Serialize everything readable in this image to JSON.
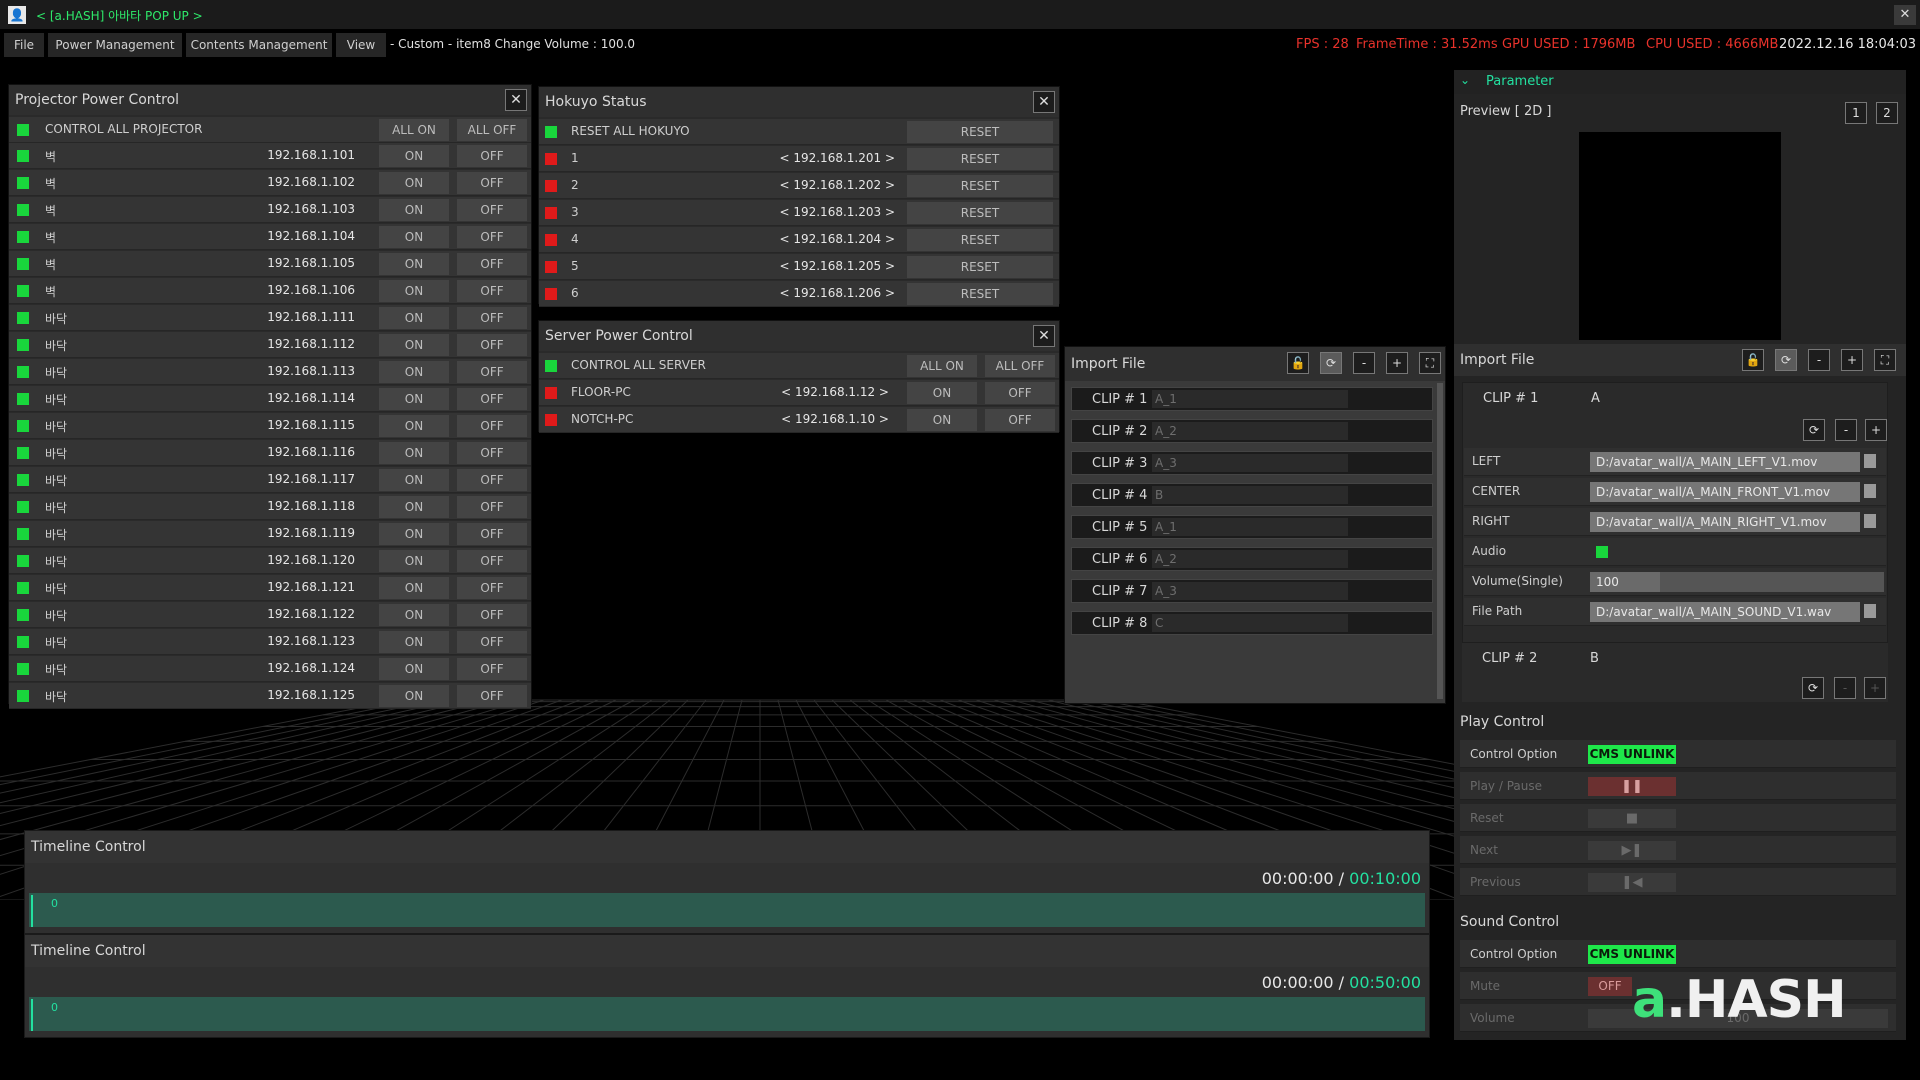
{
  "window": {
    "title": "< [a.HASH] 아바타 POP UP >",
    "close": "✕",
    "app_icon": "person-icon"
  },
  "menu": {
    "items": [
      "File",
      "Power Management",
      "Contents Management",
      "View"
    ],
    "status": "- Custom - item8 Change Volume : 100.0"
  },
  "perf": {
    "fps": "FPS : 28",
    "frametime": "FrameTime : 31.52ms",
    "gpu": "GPU USED : 1796MB",
    "cpu": "CPU USED : 4666MB",
    "clock": "2022.12.16 18:04:03"
  },
  "projector": {
    "title": "Projector Power Control",
    "all_label": "CONTROL ALL PROJECTOR",
    "all_on": "ALL ON",
    "all_off": "ALL OFF",
    "on": "ON",
    "off": "OFF",
    "rows": [
      {
        "name": "벽",
        "ip": "192.168.1.101"
      },
      {
        "name": "벽",
        "ip": "192.168.1.102"
      },
      {
        "name": "벽",
        "ip": "192.168.1.103"
      },
      {
        "name": "벽",
        "ip": "192.168.1.104"
      },
      {
        "name": "벽",
        "ip": "192.168.1.105"
      },
      {
        "name": "벽",
        "ip": "192.168.1.106"
      },
      {
        "name": "바닥",
        "ip": "192.168.1.111"
      },
      {
        "name": "바닥",
        "ip": "192.168.1.112"
      },
      {
        "name": "바닥",
        "ip": "192.168.1.113"
      },
      {
        "name": "바닥",
        "ip": "192.168.1.114"
      },
      {
        "name": "바닥",
        "ip": "192.168.1.115"
      },
      {
        "name": "바닥",
        "ip": "192.168.1.116"
      },
      {
        "name": "바닥",
        "ip": "192.168.1.117"
      },
      {
        "name": "바닥",
        "ip": "192.168.1.118"
      },
      {
        "name": "바닥",
        "ip": "192.168.1.119"
      },
      {
        "name": "바닥",
        "ip": "192.168.1.120"
      },
      {
        "name": "바닥",
        "ip": "192.168.1.121"
      },
      {
        "name": "바닥",
        "ip": "192.168.1.122"
      },
      {
        "name": "바닥",
        "ip": "192.168.1.123"
      },
      {
        "name": "바닥",
        "ip": "192.168.1.124"
      },
      {
        "name": "바닥",
        "ip": "192.168.1.125"
      }
    ]
  },
  "hokuyo": {
    "title": "Hokuyo Status",
    "all_label": "RESET ALL HOKUYO",
    "reset": "RESET",
    "rows": [
      {
        "name": "1",
        "ip": "< 192.168.1.201 >"
      },
      {
        "name": "2",
        "ip": "< 192.168.1.202 >"
      },
      {
        "name": "3",
        "ip": "< 192.168.1.203 >"
      },
      {
        "name": "4",
        "ip": "< 192.168.1.204 >"
      },
      {
        "name": "5",
        "ip": "< 192.168.1.205 >"
      },
      {
        "name": "6",
        "ip": "< 192.168.1.206 >"
      }
    ]
  },
  "server": {
    "title": "Server Power Control",
    "all_label": "CONTROL ALL SERVER",
    "all_on": "ALL ON",
    "all_off": "ALL OFF",
    "on": "ON",
    "off": "OFF",
    "rows": [
      {
        "name": "FLOOR-PC",
        "ip": "< 192.168.1.12 >"
      },
      {
        "name": "NOTCH-PC",
        "ip": "< 192.168.1.10 >"
      }
    ]
  },
  "import_left": {
    "title": "Import File",
    "toolbar": [
      "🔓",
      "⟳",
      "-",
      "+",
      "⛶"
    ],
    "clips": [
      {
        "label": "CLIP # 1",
        "value": "A_1"
      },
      {
        "label": "CLIP # 2",
        "value": "A_2"
      },
      {
        "label": "CLIP # 3",
        "value": "A_3"
      },
      {
        "label": "CLIP # 4",
        "value": "B"
      },
      {
        "label": "CLIP # 5",
        "value": "A_1"
      },
      {
        "label": "CLIP # 6",
        "value": "A_2"
      },
      {
        "label": "CLIP # 7",
        "value": "A_3"
      },
      {
        "label": "CLIP # 8",
        "value": "C"
      }
    ]
  },
  "parameter": {
    "title": "Parameter",
    "preview_label": "Preview [ 2D ]",
    "preview_btns": [
      "1",
      "2"
    ],
    "import_title": "Import File",
    "toolbar": [
      "🔓",
      "⟳",
      "-",
      "+",
      "⛶"
    ],
    "clip1": {
      "label": "CLIP # 1",
      "value": "A",
      "tools": [
        "⟳",
        "-",
        "+"
      ]
    },
    "params": [
      {
        "label": "LEFT",
        "value": "D:/avatar_wall/A_MAIN_LEFT_V1.mov"
      },
      {
        "label": "CENTER",
        "value": "D:/avatar_wall/A_MAIN_FRONT_V1.mov"
      },
      {
        "label": "RIGHT",
        "value": "D:/avatar_wall/A_MAIN_RIGHT_V1.mov"
      }
    ],
    "audio_label": "Audio",
    "volume_label": "Volume(Single)",
    "volume_value": "100",
    "filepath_label": "File Path",
    "filepath_value": "D:/avatar_wall/A_MAIN_SOUND_V1.wav",
    "clip2": {
      "label": "CLIP # 2",
      "value": "B",
      "tools": [
        "⟳",
        "-",
        "+"
      ]
    }
  },
  "play_control": {
    "title": "Play Control",
    "option_label": "Control Option",
    "option_value": "CMS UNLINK",
    "rows": [
      {
        "label": "Play / Pause",
        "glyph": "❚❚"
      },
      {
        "label": "Reset",
        "glyph": "■"
      },
      {
        "label": "Next",
        "glyph": "▶❚"
      },
      {
        "label": "Previous",
        "glyph": "❚◀"
      }
    ]
  },
  "sound_control": {
    "title": "Sound Control",
    "option_label": "Control Option",
    "option_value": "CMS UNLINK",
    "mute_label": "Mute",
    "mute_value": "OFF",
    "volume_label": "Volume",
    "volume_value": "100"
  },
  "timelines": [
    {
      "title": "Timeline Control",
      "current": "00:00:00",
      "sep": "/",
      "total": "00:10:00",
      "marker": "0"
    },
    {
      "title": "Timeline Control",
      "current": "00:00:00",
      "sep": "/",
      "total": "00:50:00",
      "marker": "0"
    }
  ],
  "logo": {
    "a": "a",
    "rest": ".HASH"
  },
  "colors": {
    "green": "#19d63c",
    "red": "#e01a1a",
    "accent": "#23e0a0",
    "cms": "#1ee84a"
  }
}
